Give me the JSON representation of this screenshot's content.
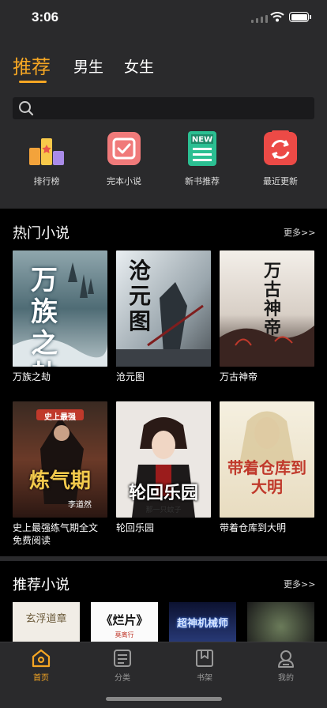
{
  "status_bar": {
    "time": "3:06"
  },
  "top_tabs": [
    {
      "label": "推荐",
      "active": true
    },
    {
      "label": "男生",
      "active": false
    },
    {
      "label": "女生",
      "active": false
    }
  ],
  "search": {
    "placeholder": ""
  },
  "quick_links": [
    {
      "label": "排行榜",
      "icon": "ranking-icon"
    },
    {
      "label": "完本小说",
      "icon": "completed-novels-icon"
    },
    {
      "label": "新书推荐",
      "icon": "new-book-icon",
      "icon_text": "NEW"
    },
    {
      "label": "最近更新",
      "icon": "recent-update-icon"
    }
  ],
  "hot_section": {
    "title": "热门小说",
    "more": "更多>>",
    "books": [
      {
        "title": "万族之劫",
        "cover_text": "万族之劫"
      },
      {
        "title": "沧元图",
        "cover_text": "沧元图"
      },
      {
        "title": "万古神帝",
        "cover_text": "万古神帝"
      },
      {
        "title_line1": "史上最强练气期全文",
        "title_line2": "免费阅读",
        "cover_text": "炼气期",
        "cover_banner": "史上最强",
        "cover_author": "李道然"
      },
      {
        "title": "轮回乐园",
        "cover_text": "轮回乐园",
        "cover_author": "那一只蚊子"
      },
      {
        "title": "带着仓库到大明",
        "cover_text": "带着仓库到大明"
      }
    ]
  },
  "recommend_section": {
    "title": "推荐小说",
    "more": "更多>>",
    "books": [
      {
        "cover_text": "玄浮道章"
      },
      {
        "cover_text": "《烂片》",
        "cover_author": "莫离行"
      },
      {
        "cover_text": "超神机械师"
      },
      {
        "cover_text": ""
      }
    ]
  },
  "tab_bar": [
    {
      "label": "首页",
      "active": true,
      "icon": "home-icon"
    },
    {
      "label": "分类",
      "active": false,
      "icon": "category-icon"
    },
    {
      "label": "书架",
      "active": false,
      "icon": "bookshelf-icon"
    },
    {
      "label": "我的",
      "active": false,
      "icon": "profile-icon"
    }
  ],
  "colors": {
    "accent": "#f5a623",
    "panel": "#2a2a2c",
    "background": "#000000"
  }
}
